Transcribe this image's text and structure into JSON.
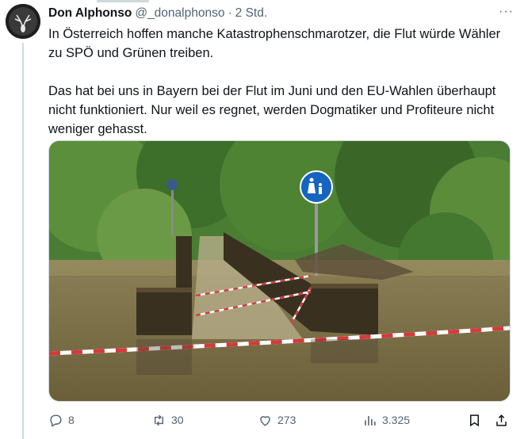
{
  "tweet": {
    "author_name": "Don Alphonso",
    "author_handle": "@_donalphonso",
    "separator": "·",
    "time": "2 Std.",
    "more_label": "···",
    "paragraphs": [
      "In Österreich hoffen manche Katastrophenschmarotzer, die Flut würde Wähler zu SPÖ und Grünen treiben.",
      "Das hat bei uns in Bayern bei der Flut im Juni und den EU-Wahlen überhaupt nicht funktioniert. Nur weil es regnet, werden Dogmatiker und Profiteure nicht weniger gehasst."
    ]
  },
  "actions": {
    "replies": "8",
    "reposts": "30",
    "likes": "273",
    "views": "3.325"
  },
  "icons": {
    "reply": "reply-icon",
    "repost": "repost-icon",
    "like": "heart-icon",
    "views": "views-icon",
    "bookmark": "bookmark-icon",
    "share": "share-icon"
  },
  "colors": {
    "text": "#0f1419",
    "secondary": "#536471",
    "border": "#cfd9de",
    "sign_blue": "#1565c0"
  }
}
